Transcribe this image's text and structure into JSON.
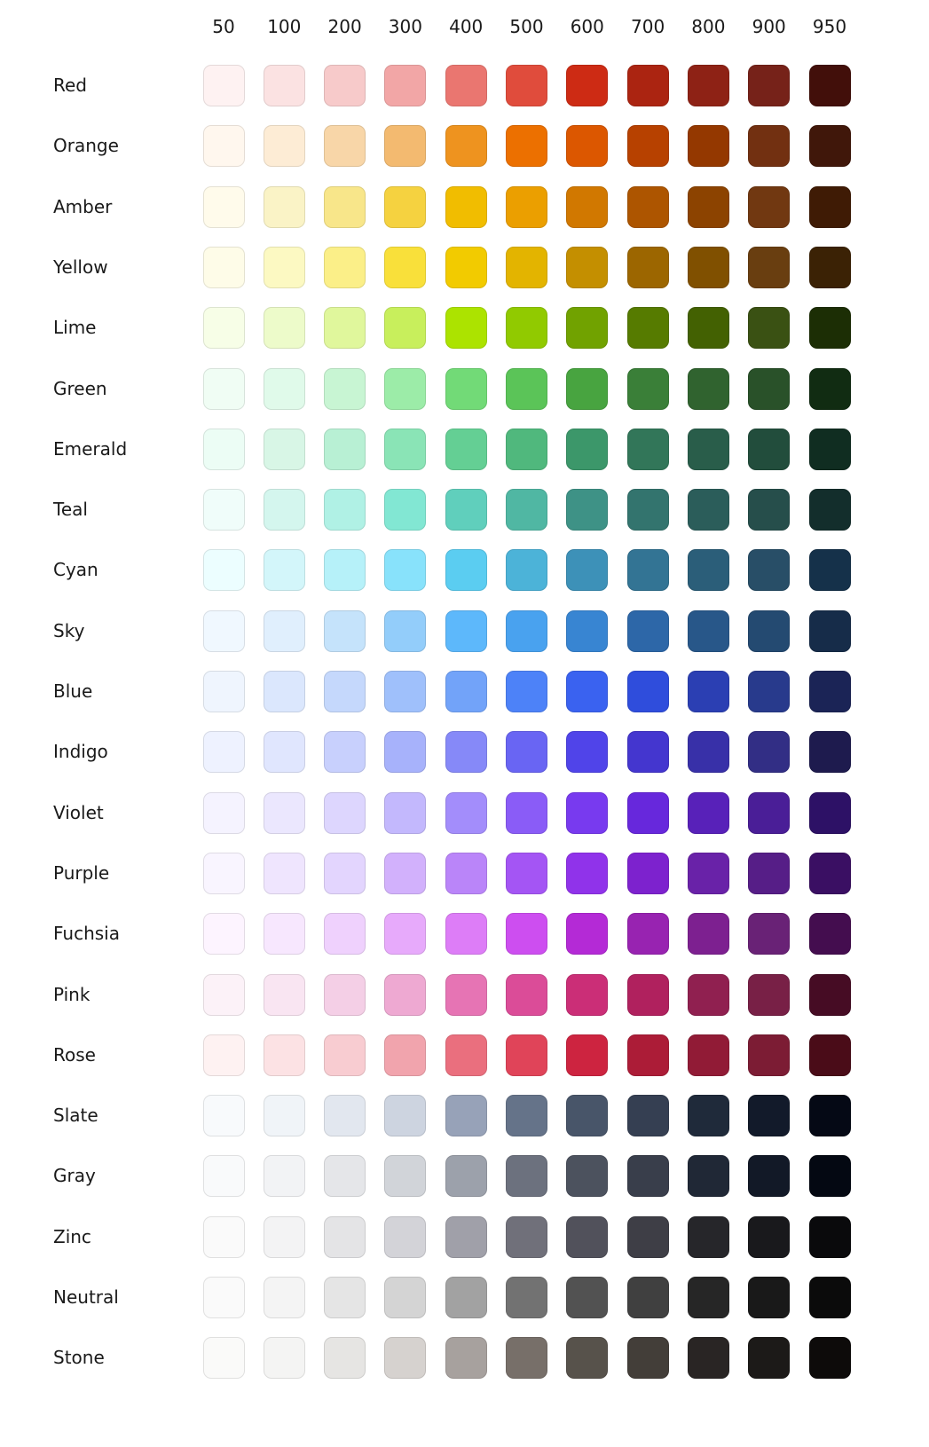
{
  "shades": [
    "50",
    "100",
    "200",
    "300",
    "400",
    "500",
    "600",
    "700",
    "800",
    "900",
    "950"
  ],
  "palette": [
    {
      "name": "Red",
      "colors": [
        "#fef2f2",
        "#fbe2e2",
        "#f7caca",
        "#f2a6a6",
        "#ea7670",
        "#e04c3c",
        "#cd2b14",
        "#ab2411",
        "#8e2215",
        "#762219",
        "#420f0a"
      ]
    },
    {
      "name": "Orange",
      "colors": [
        "#fff7ee",
        "#fdecd5",
        "#f8d6a8",
        "#f3ba70",
        "#ee931f",
        "#ec7000",
        "#dc5700",
        "#b74100",
        "#943800",
        "#723011",
        "#40170a"
      ]
    },
    {
      "name": "Amber",
      "colors": [
        "#fffbeb",
        "#faf3c6",
        "#f8e68a",
        "#f5d240",
        "#f1bd00",
        "#eb9f00",
        "#d17800",
        "#ad5500",
        "#8c4300",
        "#713811",
        "#3f1b05"
      ]
    },
    {
      "name": "Yellow",
      "colors": [
        "#fefce8",
        "#fcf9c2",
        "#fbef88",
        "#f9e03a",
        "#f2cb00",
        "#e3b400",
        "#c48f00",
        "#9c6600",
        "#805000",
        "#693e10",
        "#3b2205"
      ]
    },
    {
      "name": "Lime",
      "colors": [
        "#f7fee7",
        "#edfbca",
        "#e0f79c",
        "#c8ef5c",
        "#ace300",
        "#91ca00",
        "#71a200",
        "#567b00",
        "#436102",
        "#3a5113",
        "#1c2e05"
      ]
    },
    {
      "name": "Green",
      "colors": [
        "#f0fdf4",
        "#e0faea",
        "#c8f5d3",
        "#9ceca8",
        "#72da77",
        "#5bc458",
        "#48a440",
        "#3a7f38",
        "#30632f",
        "#295129",
        "#112c12"
      ]
    },
    {
      "name": "Emerald",
      "colors": [
        "#ecfdf5",
        "#d8f6e6",
        "#b8f0d4",
        "#8ae4b6",
        "#64cf94",
        "#50b87d",
        "#3c976a",
        "#327659",
        "#295d4a",
        "#224d3c",
        "#102d21"
      ]
    },
    {
      "name": "Teal",
      "colors": [
        "#f0fdfa",
        "#d4f6ee",
        "#b0f1e5",
        "#82e7d3",
        "#60cfbc",
        "#50b7a3",
        "#3e9286",
        "#33746e",
        "#2b5d5a",
        "#264e4b",
        "#132e2c"
      ]
    },
    {
      "name": "Cyan",
      "colors": [
        "#ecfeff",
        "#d3f6fa",
        "#b6f1f9",
        "#88e2fb",
        "#5bcdf1",
        "#4cb3d8",
        "#3d91b8",
        "#337494",
        "#2b5e79",
        "#284e67",
        "#15314a"
      ]
    },
    {
      "name": "Sky",
      "colors": [
        "#f0f8ff",
        "#e0effd",
        "#c5e3fb",
        "#93cdfa",
        "#5db8fb",
        "#49a2ef",
        "#3885d2",
        "#2d67a8",
        "#285789",
        "#244a71",
        "#162c49"
      ]
    },
    {
      "name": "Blue",
      "colors": [
        "#eff5fe",
        "#dbe7fd",
        "#c5d8fc",
        "#9fc0fb",
        "#72a3f9",
        "#4d82f8",
        "#3a62f0",
        "#2f4ddc",
        "#2b3fb3",
        "#283a8c",
        "#1b2456"
      ]
    },
    {
      "name": "Indigo",
      "colors": [
        "#eef2ff",
        "#e0e6fe",
        "#c8d0fd",
        "#a7b2fb",
        "#8689f8",
        "#6965f3",
        "#5044e9",
        "#4436cf",
        "#3830a8",
        "#322e85",
        "#1e1b4e"
      ]
    },
    {
      "name": "Violet",
      "colors": [
        "#f5f3ff",
        "#ebe7fe",
        "#ddd6fe",
        "#c3b8fd",
        "#a38dfb",
        "#8a5cf7",
        "#783aef",
        "#6728dc",
        "#5821b9",
        "#4a1e97",
        "#2d1166"
      ]
    },
    {
      "name": "Purple",
      "colors": [
        "#f9f5ff",
        "#efe5fe",
        "#e3d5fe",
        "#d2b1fc",
        "#ba85f9",
        "#a455f4",
        "#9033ea",
        "#7d22ce",
        "#6922a8",
        "#561e87",
        "#3a0f63"
      ]
    },
    {
      "name": "Fuchsia",
      "colors": [
        "#fdf4ff",
        "#f7e7fe",
        "#efd1fd",
        "#e7aafb",
        "#dd7df7",
        "#cd4ef0",
        "#b42ad6",
        "#9823b1",
        "#7d2090",
        "#692276",
        "#440d4f"
      ]
    },
    {
      "name": "Pink",
      "colors": [
        "#fcf2f8",
        "#f9e5f2",
        "#f4cfe6",
        "#eea9d2",
        "#e674b4",
        "#db4c98",
        "#cb2e77",
        "#b0215e",
        "#902050",
        "#782046",
        "#460c24"
      ]
    },
    {
      "name": "Rose",
      "colors": [
        "#fef2f2",
        "#fce2e4",
        "#f8ccd1",
        "#f1a4ad",
        "#ea6f7e",
        "#e04459",
        "#cd2440",
        "#ac1c37",
        "#911b36",
        "#7c1c34",
        "#4a0c18"
      ]
    },
    {
      "name": "Slate",
      "colors": [
        "#f8fafc",
        "#f0f4f8",
        "#e2e7ef",
        "#cdd4e0",
        "#97a2b8",
        "#657389",
        "#485569",
        "#353f52",
        "#1f2a3a",
        "#121a2a",
        "#050915"
      ]
    },
    {
      "name": "Gray",
      "colors": [
        "#f9fafb",
        "#f2f3f5",
        "#e5e6e9",
        "#d1d4d9",
        "#9ca1ab",
        "#6c717e",
        "#4c525e",
        "#393e4b",
        "#202836",
        "#121927",
        "#040812"
      ]
    },
    {
      "name": "Zinc",
      "colors": [
        "#fafafa",
        "#f3f3f4",
        "#e4e4e6",
        "#d3d3d8",
        "#a0a0a9",
        "#70707a",
        "#51515b",
        "#3e3e46",
        "#26262a",
        "#19191c",
        "#0a0a0c"
      ]
    },
    {
      "name": "Neutral",
      "colors": [
        "#fafafa",
        "#f4f4f4",
        "#e5e5e5",
        "#d4d4d4",
        "#a2a2a2",
        "#727272",
        "#525252",
        "#404040",
        "#262626",
        "#191919",
        "#0b0b0b"
      ]
    },
    {
      "name": "Stone",
      "colors": [
        "#fafaf9",
        "#f4f4f3",
        "#e6e5e3",
        "#d6d2cf",
        "#a7a19e",
        "#776f69",
        "#57524b",
        "#433e39",
        "#292524",
        "#1c1a18",
        "#0d0b0a"
      ]
    }
  ]
}
